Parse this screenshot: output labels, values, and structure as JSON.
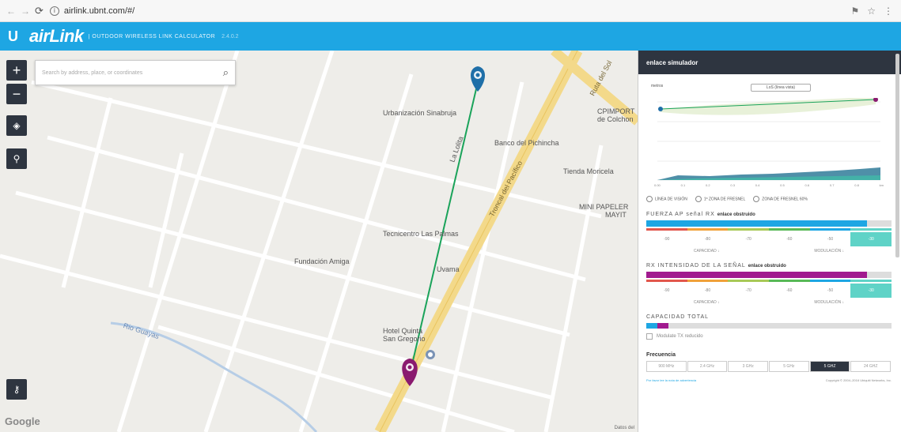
{
  "browser": {
    "url": "airlink.ubnt.com/#/"
  },
  "header": {
    "logo": "U",
    "app_name": "airLink",
    "subtitle": "| OUTDOOR WIRELESS LINK CALCULATOR",
    "version": "2.4.0.2"
  },
  "map": {
    "search_placeholder": "Search by address, place, or coordinates",
    "zoom_in": "+",
    "zoom_out": "−",
    "labels": {
      "urbanizacion": "Urbanización Sinabruja",
      "cpimport": "CPIMPORT",
      "colchoneria": "de Colchon",
      "banco": "Banco del Pichincha",
      "tienda": "Tienda Moricela",
      "mini": "MINI PAPELER",
      "mayit": "MAYIT",
      "tecnicentro": "Tecnicentro Las Palmas",
      "fundacion": "Fundación Amiga",
      "uvama": "Uvama",
      "hotel1": "Hotel Quinta",
      "hotel2": "San Gregorio",
      "rio": "Rio Guayas",
      "troncal": "Troncal del Pacífico",
      "rutasol": "Ruta del Sol",
      "lalolita": "La Lolita"
    },
    "google": "Google",
    "attribution": "Datos del"
  },
  "panel": {
    "title": "enlace simulador",
    "profile_top_label": "metros",
    "profile_chip": "LoS (línea vista)",
    "profile_x_ticks": [
      "0.00",
      "0.1",
      "0.2",
      "0.3",
      "0.4",
      "0.5",
      "0.6",
      "0.7",
      "0.8",
      "km"
    ],
    "legend": {
      "los": "LÍNEA DE VISIÓN",
      "fresnel": "1ª ZONA DE FRESNEL",
      "fresnel60": "ZONA DE FRESNEL 60%"
    },
    "ap_signal": {
      "title": "FUERZA AP señal RX",
      "status": "enlace obstruido",
      "fill_fraction": 0.9,
      "ticks": [
        "-90",
        "-80",
        "-70",
        "-60",
        "-50",
        "-30"
      ],
      "sub_left": "CAPACIDAD ↓",
      "sub_right": "MODULACIÓN ↓"
    },
    "rx_signal": {
      "title": "RX INTENSIDAD DE LA SEÑAL",
      "status": "enlace obstruido",
      "fill_fraction": 0.9,
      "ticks": [
        "-90",
        "-80",
        "-70",
        "-60",
        "-50",
        "-30"
      ],
      "sub_left": "CAPACIDAD ↓",
      "sub_right": "MODULACIÓN ↓"
    },
    "capacity": {
      "title": "CAPACIDAD TOTAL",
      "fill_fraction": 0.09,
      "checkbox_label": "Modulate TX reducido"
    },
    "frequency": {
      "title": "Frecuencia",
      "options": [
        "900 MHz",
        "2.4 GHz",
        "3 GHz",
        "5 GHz",
        "5 GHZ",
        "24 GHZ"
      ],
      "active_index": 4
    },
    "footer": {
      "left": "Por favor lee la nota de advertencia",
      "right": "Copyright © 2004–2016 Ubiquiti Networks, Inc."
    }
  },
  "colors": {
    "brand_blue": "#1ea6e3",
    "panel_dark": "#2e3540",
    "link_line": "#1aa35a",
    "ap_pin": "#1f6fa8",
    "station_pin": "#8a1a6f",
    "road_yellow": "#f3d98a",
    "ap_bar": "#1ea6e3",
    "rx_bar": "#a11a8f",
    "highlight": "#5fd3c7"
  }
}
